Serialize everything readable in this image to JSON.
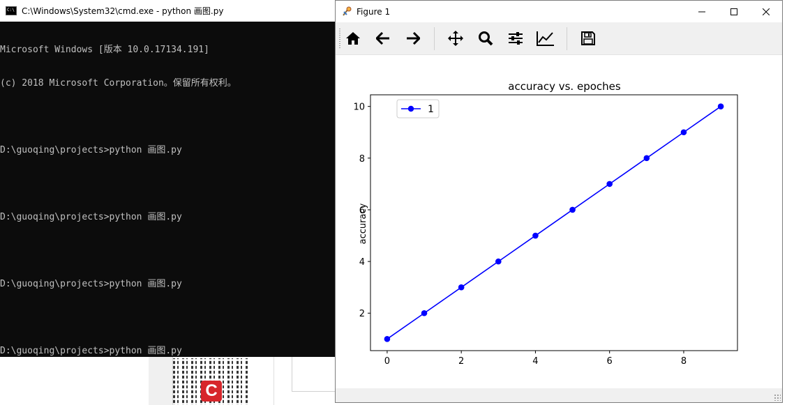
{
  "cmd_window": {
    "title": "C:\\Windows\\System32\\cmd.exe - python  画图.py",
    "lines": [
      "Microsoft Windows [版本 10.0.17134.191]",
      "(c) 2018 Microsoft Corporation。保留所有权利。",
      "",
      "D:\\guoqing\\projects>python 画图.py",
      "",
      "D:\\guoqing\\projects>python 画图.py",
      "",
      "D:\\guoqing\\projects>python 画图.py",
      "",
      "D:\\guoqing\\projects>python 画图.py"
    ]
  },
  "figure_window": {
    "title": "Figure 1",
    "toolbar": {
      "home": "home-icon",
      "back": "arrow-left-icon",
      "forward": "arrow-right-icon",
      "pan": "move-icon",
      "zoom": "magnifier-icon",
      "subplots": "sliders-icon",
      "customize": "line-chart-icon",
      "save": "floppy-disk-icon"
    }
  },
  "chart_data": {
    "type": "line",
    "title": "accuracy vs. epoches",
    "xlabel": "",
    "ylabel": "accuracy",
    "x": [
      0,
      1,
      2,
      3,
      4,
      5,
      6,
      7,
      8,
      9
    ],
    "series": [
      {
        "name": "1",
        "values": [
          1,
          2,
          3,
          4,
          5,
          6,
          7,
          8,
          9,
          10
        ],
        "color": "#0000ff",
        "marker": "circle"
      }
    ],
    "xticks": [
      0,
      2,
      4,
      6,
      8
    ],
    "yticks": [
      2,
      4,
      6,
      8,
      10
    ],
    "xlim": [
      -0.45,
      9.45
    ],
    "ylim": [
      0.55,
      10.45
    ],
    "legend": "upper-left",
    "grid": false
  }
}
